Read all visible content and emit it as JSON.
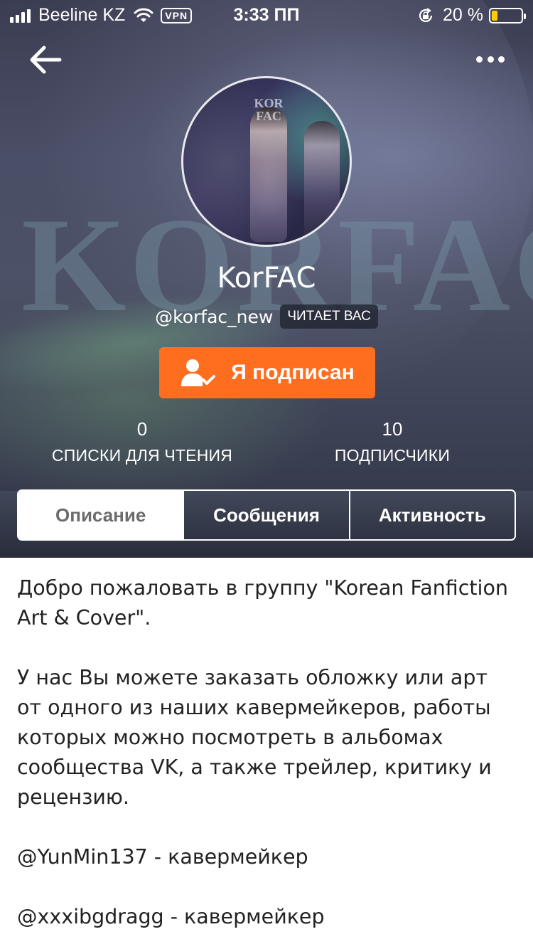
{
  "status_bar": {
    "carrier": "Beeline KZ",
    "vpn": "VPN",
    "time": "3:33 ПП",
    "battery_percent": "20 %",
    "battery_level": 0.2,
    "battery_color": "#ffcc00"
  },
  "nav": {
    "back_icon": "arrow-left-icon",
    "more_icon": "more-horizontal-icon"
  },
  "hero": {
    "background_word": "KORFAC",
    "avatar_text": "KOR FAC"
  },
  "profile": {
    "display_name": "KorFAC",
    "username": "@korfac_new",
    "follows_you_badge": "ЧИТАЕТ ВАС",
    "follow_button": "Я подписан",
    "accent_color": "#ff6d1f"
  },
  "stats": [
    {
      "value": "0",
      "label": "СПИСКИ ДЛЯ ЧТЕНИЯ"
    },
    {
      "value": "10",
      "label": "ПОДПИСЧИКИ"
    }
  ],
  "tabs": [
    {
      "label": "Описание",
      "active": true
    },
    {
      "label": "Сообщения",
      "active": false
    },
    {
      "label": "Активность",
      "active": false
    }
  ],
  "description": {
    "paragraphs": [
      "Добро пожаловать в группу \"Korean Fanfiction Art & Cover\".",
      "У нас Вы можете заказать обложку или арт от одного из наших кавермейкеров, работы которых можно посмотреть в альбомах сообщества VK, а также трейлер, критику и рецензию.",
      "@YunMin137 - кавермейкер",
      "@xxxibgdragg - кавермейкер"
    ]
  }
}
